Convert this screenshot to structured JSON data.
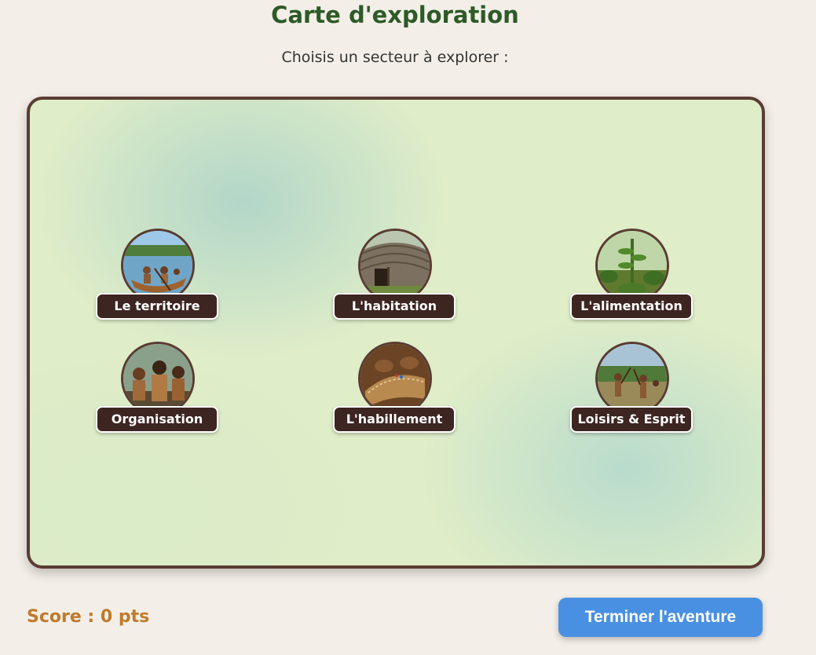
{
  "header": {
    "title": "Carte d'exploration",
    "subtitle": "Choisis un secteur à explorer :"
  },
  "sectors": [
    {
      "label": "Le territoire",
      "image": "canoe-lake-illustration"
    },
    {
      "label": "L'habitation",
      "image": "longhouse-illustration"
    },
    {
      "label": "L'alimentation",
      "image": "corn-field-illustration"
    },
    {
      "label": "Organisation",
      "image": "group-gathering-illustration"
    },
    {
      "label": "L'habillement",
      "image": "beadwork-sewing-illustration"
    },
    {
      "label": "Loisirs & Esprit",
      "image": "lacrosse-game-illustration"
    }
  ],
  "footer": {
    "score": "Score : 0 pts",
    "finish_label": "Terminer l'aventure"
  },
  "colors": {
    "title": "#2d5a27",
    "map_border": "#5a3c32",
    "label_bg": "#3d2522",
    "score": "#c07a2c",
    "button": "#4a90e2"
  }
}
